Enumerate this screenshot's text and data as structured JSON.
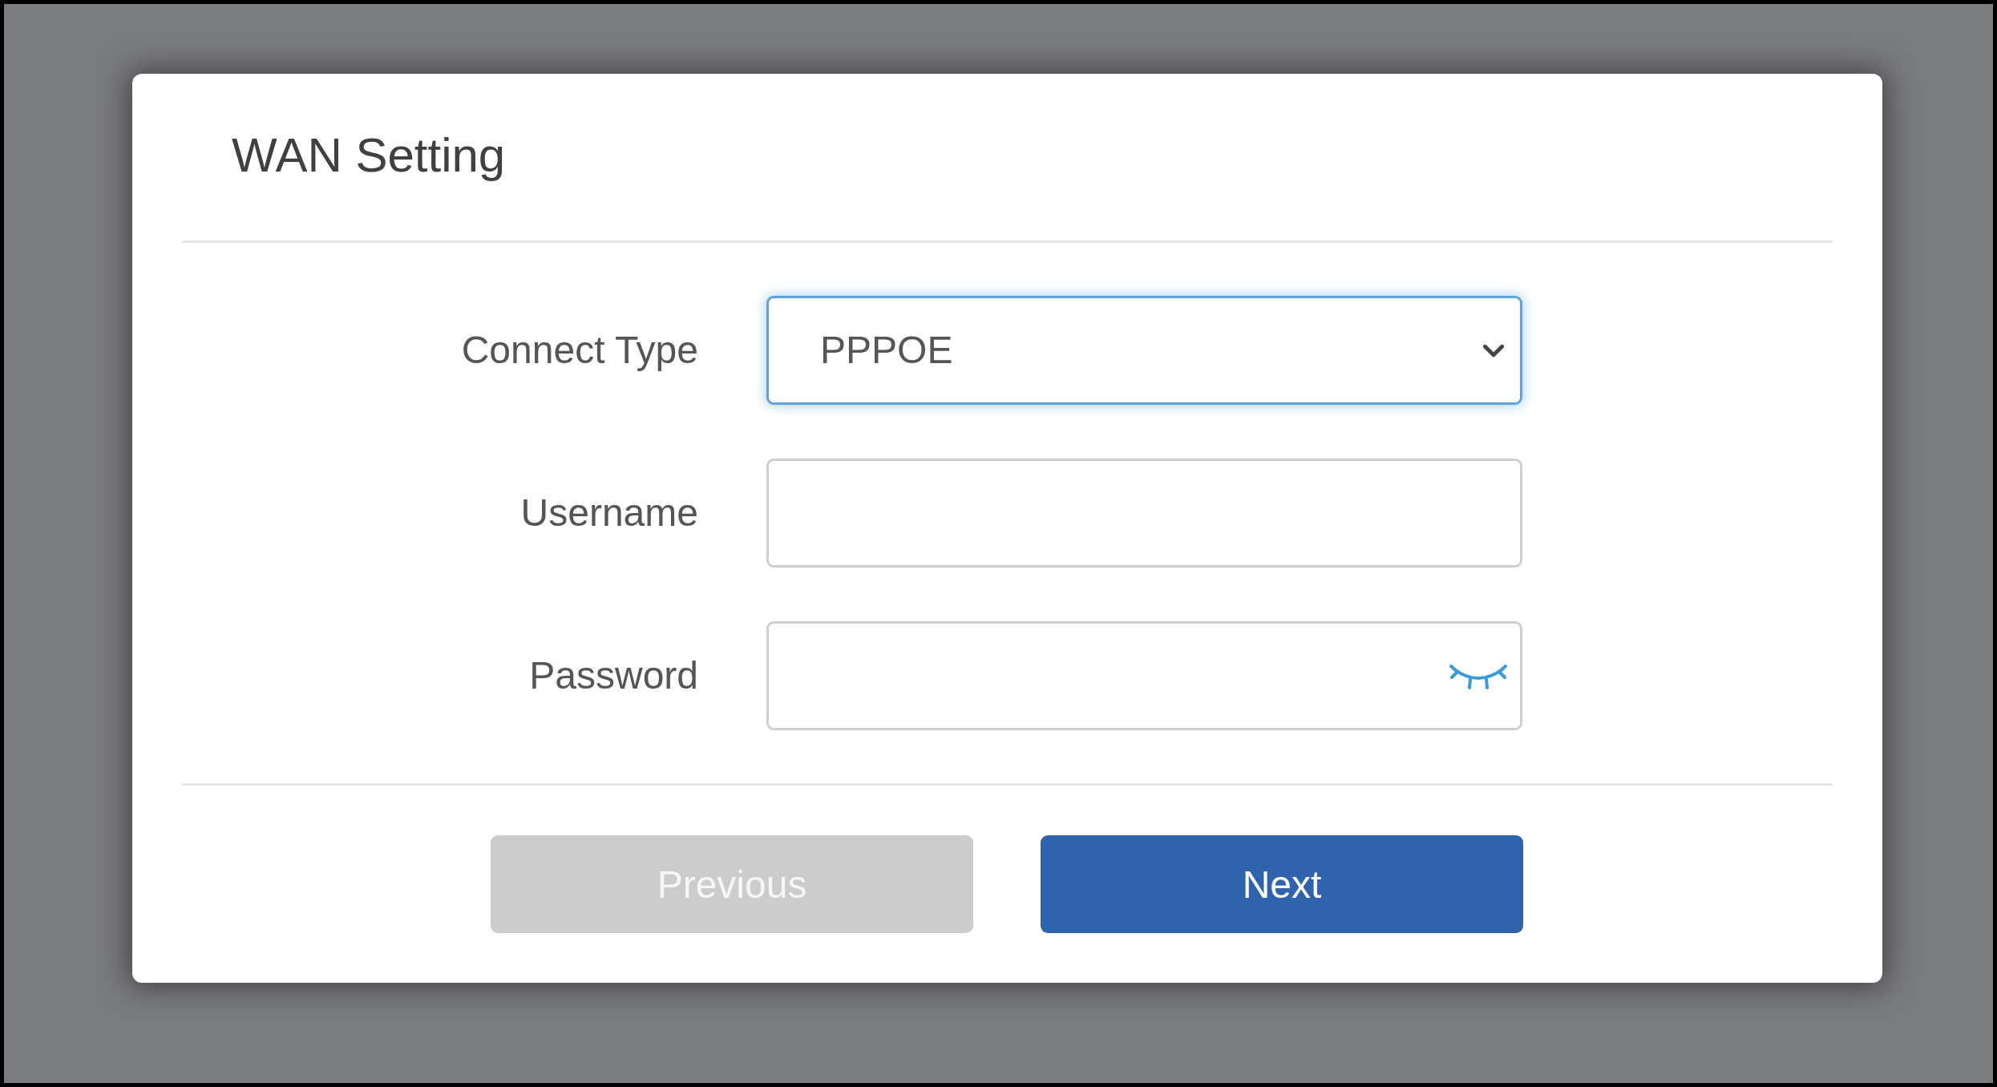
{
  "dialog": {
    "title": "WAN Setting"
  },
  "fields": [
    {
      "kind": "select",
      "label": "Connect Type",
      "value": "PPPOE",
      "focused": true
    },
    {
      "kind": "text",
      "label": "Username",
      "focused": false
    },
    {
      "kind": "password",
      "label": "Password",
      "focused": false
    }
  ],
  "buttons": [
    {
      "label": "Previous",
      "disabled": true
    },
    {
      "label": "Next",
      "disabled": false
    }
  ]
}
